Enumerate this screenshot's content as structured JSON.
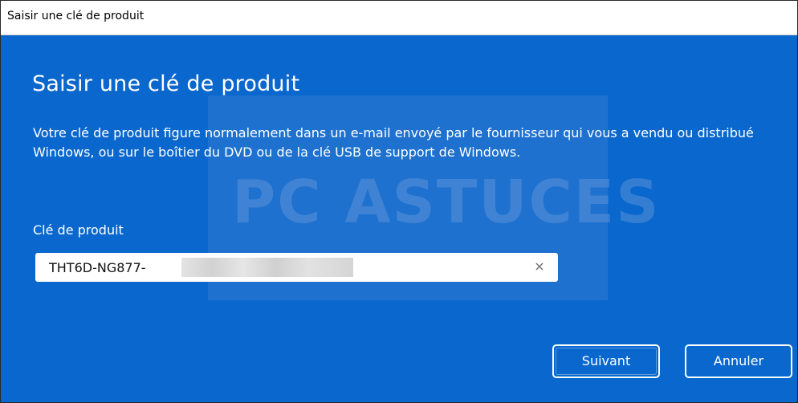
{
  "window": {
    "title": "Saisir une clé de produit"
  },
  "dialog": {
    "heading": "Saisir une clé de produit",
    "description": "Votre clé de produit figure normalement dans un e-mail envoyé par le fournisseur qui vous a vendu ou distribué Windows, ou sur le boîtier du DVD ou de la clé USB de support de Windows.",
    "field_label": "Clé de produit",
    "product_key_value": "THT6D-NG877-",
    "clear_icon": "close-icon",
    "clear_glyph": "×",
    "next_button_label": "Suivant",
    "cancel_button_label": "Annuler"
  },
  "watermark": {
    "text": "PC ASTUCES"
  },
  "colors": {
    "background": "#0a67cd",
    "text": "#ffffff",
    "titlebar": "#ffffff"
  }
}
